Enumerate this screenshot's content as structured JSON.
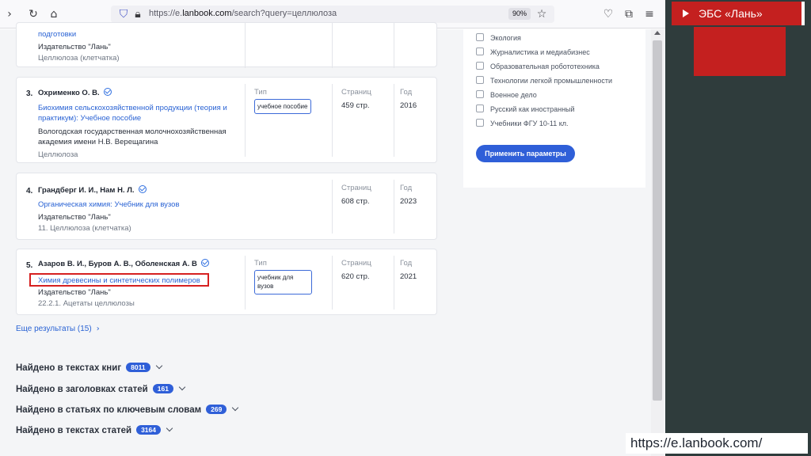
{
  "browser": {
    "url_prefix": "https://e.",
    "url_domain": "lanbook.com",
    "url_path": "/search?query=целлюлоза",
    "zoom": "90%"
  },
  "results": [
    {
      "title_tail": "подготовки",
      "publisher": "Издательство \"Лань\"",
      "section": "Целлюлоза (клетчатка)"
    },
    {
      "num": "3.",
      "authors": "Охрименко О. В.",
      "title": "Биохимия сельскохозяйственной продукции (теория и практикум): Учебное пособие",
      "publisher": "Вологодская государственная молочнохозяйственная академия имени Н.В. Верещагина",
      "section": "Целлюлоза",
      "type_label": "Тип",
      "type_value": "учебное пособие",
      "pages_label": "Страниц",
      "pages_value": "459 стр.",
      "year_label": "Год",
      "year_value": "2016"
    },
    {
      "num": "4.",
      "authors": "Грандберг И. И., Нам Н. Л.",
      "title": "Органическая химия: Учебник для вузов",
      "publisher": "Издательство \"Лань\"",
      "section": "11. Целлюлоза (клетчатка)",
      "pages_label": "Страниц",
      "pages_value": "608 стр.",
      "year_label": "Год",
      "year_value": "2023"
    },
    {
      "num": "5.",
      "authors": "Азаров В. И., Буров А. В., Оболенская А. В",
      "title": "Химия древесины и синтетических полимеров",
      "publisher": "Издательство \"Лань\"",
      "section": "22.2.1. Ацетаты целлюлозы",
      "type_label": "Тип",
      "type_value": "учебник для вузов",
      "pages_label": "Страниц",
      "pages_value": "620 стр.",
      "year_label": "Год",
      "year_value": "2021"
    }
  ],
  "more_results": "Еще результаты (15)",
  "found_groups": [
    {
      "label": "Найдено в текстах книг",
      "count": "8011"
    },
    {
      "label": "Найдено в заголовках статей",
      "count": "161"
    },
    {
      "label": "Найдено в статьях по ключевым словам",
      "count": "269"
    },
    {
      "label": "Найдено в текстах статей",
      "count": "3164"
    }
  ],
  "filters": {
    "items": [
      "Экология",
      "Журналистика и медиабизнес",
      "Образовательная робототехника",
      "Технологии легкой промышленности",
      "Военное дело",
      "Русский как иностранный",
      "Учебники ФГУ 10-11 кл."
    ],
    "apply_label": "Применить параметры"
  },
  "slide": {
    "title": "ЭБС «Лань»",
    "footer_url": "https://e.lanbook.com/"
  },
  "colors": {
    "accent": "#2f5fd8",
    "slide_red": "#c4201f",
    "highlight_red": "#d62020"
  }
}
